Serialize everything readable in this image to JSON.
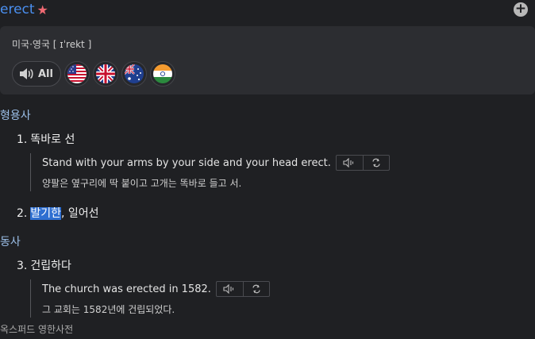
{
  "entry": {
    "headword": "erect",
    "star_glyph": "★"
  },
  "pronunciation": {
    "label": "미국·영국 [ ɪˈrekt ]",
    "all_label": "All",
    "flags": [
      "us-flag",
      "uk-flag",
      "australia-flag",
      "india-flag"
    ]
  },
  "sections": [
    {
      "pos": "형용사",
      "senses": [
        {
          "num": "1.",
          "text": "똑바로 선",
          "example_en": "Stand with your arms by your side and your head erect.",
          "example_ko": "양팔은 옆구리에 딱 붙이고 고개는 똑바로 들고 서."
        },
        {
          "num": "2.",
          "text_highlight": "발기한",
          "text_rest": ", 일어선"
        }
      ]
    },
    {
      "pos": "동사",
      "senses": [
        {
          "num": "3.",
          "text": "건립하다",
          "example_en": "The church was erected in 1582.",
          "example_ko": "그 교회는 1582년에 건립되었다."
        }
      ]
    }
  ],
  "source": "옥스퍼드 영한사전",
  "colors": {
    "background": "#1f2023",
    "headword": "#4a8ff0",
    "pos": "#9cc0ea",
    "highlight": "#2f6fd1"
  }
}
